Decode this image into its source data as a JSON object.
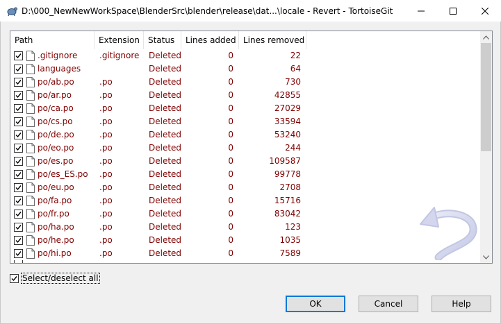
{
  "window": {
    "title": "D:\\000_NewNewWorkSpace\\BlenderSrc\\blender\\release\\dat...\\locale - Revert - TortoiseGit"
  },
  "columns": {
    "path": "Path",
    "extension": "Extension",
    "status": "Status",
    "lines_added": "Lines added",
    "lines_removed": "Lines removed"
  },
  "rows": [
    {
      "path": ".gitignore",
      "ext": ".gitignore",
      "status": "Deleted",
      "added": "0",
      "removed": "22",
      "checked": true
    },
    {
      "path": "languages",
      "ext": "",
      "status": "Deleted",
      "added": "0",
      "removed": "64",
      "checked": true
    },
    {
      "path": "po/ab.po",
      "ext": ".po",
      "status": "Deleted",
      "added": "0",
      "removed": "730",
      "checked": true
    },
    {
      "path": "po/ar.po",
      "ext": ".po",
      "status": "Deleted",
      "added": "0",
      "removed": "42855",
      "checked": true
    },
    {
      "path": "po/ca.po",
      "ext": ".po",
      "status": "Deleted",
      "added": "0",
      "removed": "27029",
      "checked": true
    },
    {
      "path": "po/cs.po",
      "ext": ".po",
      "status": "Deleted",
      "added": "0",
      "removed": "33594",
      "checked": true
    },
    {
      "path": "po/de.po",
      "ext": ".po",
      "status": "Deleted",
      "added": "0",
      "removed": "53240",
      "checked": true
    },
    {
      "path": "po/eo.po",
      "ext": ".po",
      "status": "Deleted",
      "added": "0",
      "removed": "244",
      "checked": true
    },
    {
      "path": "po/es.po",
      "ext": ".po",
      "status": "Deleted",
      "added": "0",
      "removed": "109587",
      "checked": true
    },
    {
      "path": "po/es_ES.po",
      "ext": ".po",
      "status": "Deleted",
      "added": "0",
      "removed": "99778",
      "checked": true
    },
    {
      "path": "po/eu.po",
      "ext": ".po",
      "status": "Deleted",
      "added": "0",
      "removed": "2708",
      "checked": true
    },
    {
      "path": "po/fa.po",
      "ext": ".po",
      "status": "Deleted",
      "added": "0",
      "removed": "15716",
      "checked": true
    },
    {
      "path": "po/fr.po",
      "ext": ".po",
      "status": "Deleted",
      "added": "0",
      "removed": "83042",
      "checked": true
    },
    {
      "path": "po/ha.po",
      "ext": ".po",
      "status": "Deleted",
      "added": "0",
      "removed": "123",
      "checked": true
    },
    {
      "path": "po/he.po",
      "ext": ".po",
      "status": "Deleted",
      "added": "0",
      "removed": "1035",
      "checked": true
    },
    {
      "path": "po/hi.po",
      "ext": ".po",
      "status": "Deleted",
      "added": "0",
      "removed": "7589",
      "checked": true
    }
  ],
  "select_all": {
    "label": "Select/deselect all",
    "checked": true
  },
  "buttons": {
    "ok": "OK",
    "cancel": "Cancel",
    "help": "Help"
  },
  "colors": {
    "deleted_text": "#800000",
    "default_button_border": "#0078d7"
  }
}
